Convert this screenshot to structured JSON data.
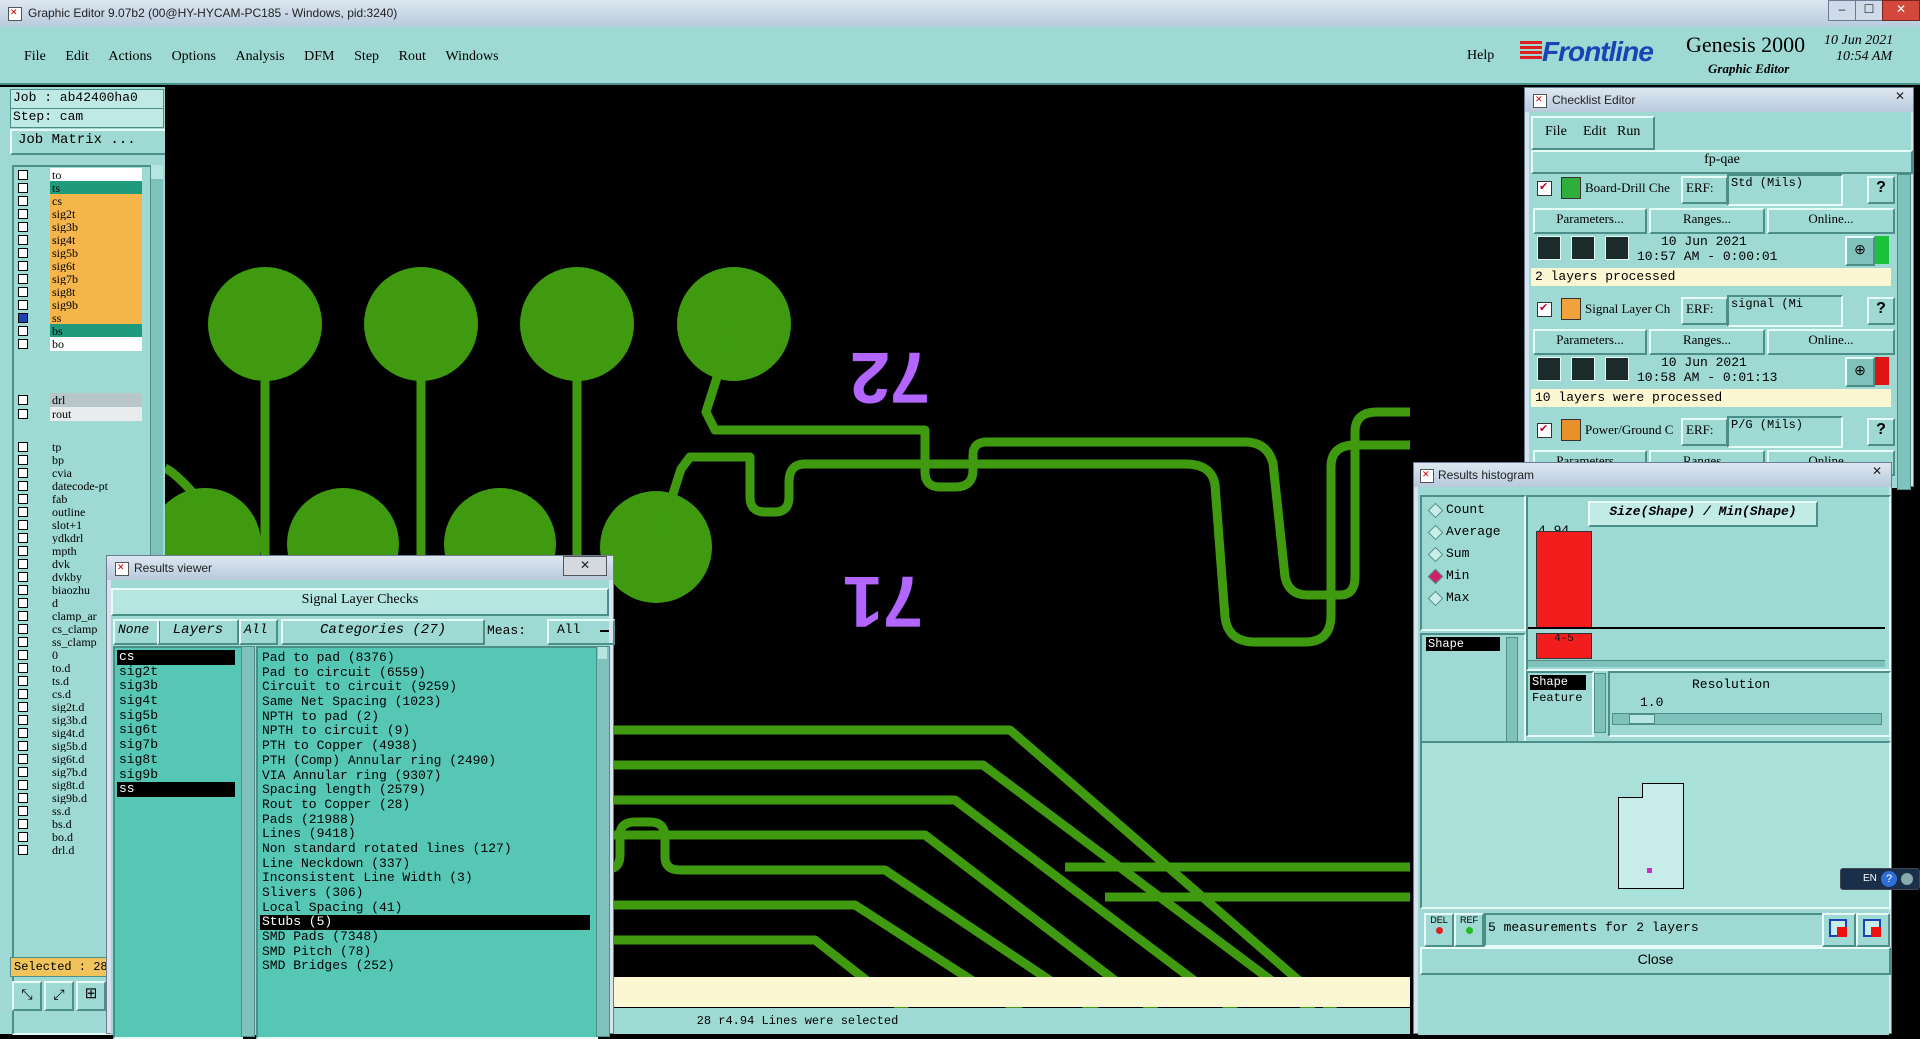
{
  "window": {
    "title": "Graphic Editor 9.07b2 (00@HY-HYCAM-PC185 - Windows, pid:3240)"
  },
  "menu": {
    "items": [
      "File",
      "Edit",
      "Actions",
      "Options",
      "Analysis",
      "DFM",
      "Step",
      "Rout",
      "Windows"
    ],
    "help": "Help"
  },
  "brand": {
    "logo": "Frontline",
    "product": "Genesis 2000",
    "subtitle": "Graphic Editor",
    "date": "10 Jun 2021",
    "time": "10:54 AM"
  },
  "job": {
    "job_label": "Job : ab42400ha0",
    "step_label": "Step: cam",
    "matrix_button": "Job Matrix ..."
  },
  "layers": {
    "group1": [
      {
        "name": "to",
        "color": "#ffffff"
      },
      {
        "name": "ts",
        "color": "#1f9a7c"
      },
      {
        "name": "cs",
        "color": "#f5b54b"
      },
      {
        "name": "sig2t",
        "color": "#f5b54b"
      },
      {
        "name": "sig3b",
        "color": "#f5b54b"
      },
      {
        "name": "sig4t",
        "color": "#f5b54b"
      },
      {
        "name": "sig5b",
        "color": "#f5b54b"
      },
      {
        "name": "sig6t",
        "color": "#f5b54b"
      },
      {
        "name": "sig7b",
        "color": "#f5b54b"
      },
      {
        "name": "sig8t",
        "color": "#f5b54b"
      },
      {
        "name": "sig9b",
        "color": "#f5b54b"
      },
      {
        "name": "ss",
        "color": "#f5b54b"
      },
      {
        "name": "bs",
        "color": "#1f9a7c"
      },
      {
        "name": "bo",
        "color": "#ffffff"
      }
    ],
    "group2": [
      {
        "name": "drl",
        "color": "#b9c6c7"
      },
      {
        "name": "rout",
        "color": "#e8ecec"
      }
    ],
    "group3": [
      "tp",
      "bp",
      "cvia",
      "datecode-pt",
      "fab",
      "outline",
      "slot+1",
      "ydkdrl",
      "mpth",
      "dvk",
      "dvkby",
      "biaozhu",
      "d",
      "clamp_ar",
      "cs_clamp",
      "ss_clamp",
      "0",
      "to.d",
      "ts.d",
      "cs.d",
      "sig2t.d",
      "sig3b.d",
      "sig4t.d",
      "sig5b.d",
      "sig6t.d",
      "sig7b.d",
      "sig8t.d",
      "sig9b.d",
      "ss.d",
      "bs.d",
      "bo.d",
      "drl.d"
    ],
    "selected_label": "Selected : 28"
  },
  "canvas": {
    "labels": [
      "72",
      "71"
    ],
    "status": "28 r4.94 Lines were selected"
  },
  "results_viewer": {
    "title": "Results viewer",
    "heading": "Signal Layer Checks",
    "none_btn": "None",
    "layers_btn": "Layers",
    "all_btn": "All",
    "categories_btn": "Categories (27)",
    "meas_label": "Meas:",
    "meas_value": "All",
    "layers": [
      "cs",
      "sig2t",
      "sig3b",
      "sig4t",
      "sig5b",
      "sig6t",
      "sig7b",
      "sig8t",
      "sig9b",
      "ss"
    ],
    "categories": [
      "Pad to pad (8376)",
      "Pad to circuit (6559)",
      "Circuit to circuit (9259)",
      "Same Net Spacing (1023)",
      "NPTH to pad (2)",
      "NPTH to circuit (9)",
      "PTH to Copper (4938)",
      "PTH (Comp) Annular ring (2490)",
      "VIA Annular ring (9307)",
      "Spacing length (2579)",
      "Rout to Copper (28)",
      "Pads (21988)",
      "Lines (9418)",
      "Non standard rotated lines (127)",
      "Line Neckdown (337)",
      "Inconsistent Line Width (3)",
      "Slivers (306)",
      "Local Spacing (41)",
      "Stubs (5)",
      "SMD Pads (7348)",
      "SMD Pitch (78)",
      "SMD Bridges (252)"
    ]
  },
  "checklist": {
    "title": "Checklist Editor",
    "menu": [
      "File",
      "Edit",
      "Run"
    ],
    "name": "fp-qae",
    "items": [
      {
        "name": "Board-Drill Che",
        "erf": "ERF:",
        "erf_value": "Std (Mils)",
        "date": "10 Jun 2021",
        "time": "10:57 AM - 0:00:01",
        "summary": "2 layers processed",
        "status_color": "#19c23a",
        "icon_color": "#2fae3b"
      },
      {
        "name": "Signal Layer Ch",
        "erf": "ERF:",
        "erf_value": "signal (Mi",
        "date": "10 Jun 2021",
        "time": "10:58 AM - 0:01:13",
        "summary": "10 layers were processed",
        "status_color": "#e11414",
        "icon_color": "#f2a23a"
      },
      {
        "name": "Power/Ground C",
        "erf": "ERF:",
        "erf_value": "P/G (Mils)",
        "date": "",
        "time": "",
        "summary": "",
        "status_color": "",
        "icon_color": "#e8902a"
      }
    ],
    "parameters_btn": "Parameters...",
    "ranges_btn": "Ranges...",
    "online_btn": "Online...",
    "help_btn": "?"
  },
  "histogram": {
    "title": "Results histogram",
    "options": [
      "Count",
      "Average",
      "Sum",
      "Min",
      "Max"
    ],
    "selected_option": "Min",
    "chart_title": "Size(Shape) / Min(Shape)",
    "bar_value": "4.94",
    "bar_fraction": 1.0,
    "bar_range": "4-5",
    "left_list": [
      "Shape"
    ],
    "sort_list": [
      "Shape",
      "Feature"
    ],
    "resolution_label": "Resolution",
    "resolution_value": "1.0",
    "del_btn": "DEL",
    "ref_btn": "REF",
    "measurements": "5 measurements for 2 layers",
    "close_btn": "Close"
  },
  "tray": {
    "lang": "EN",
    "help": "?"
  }
}
